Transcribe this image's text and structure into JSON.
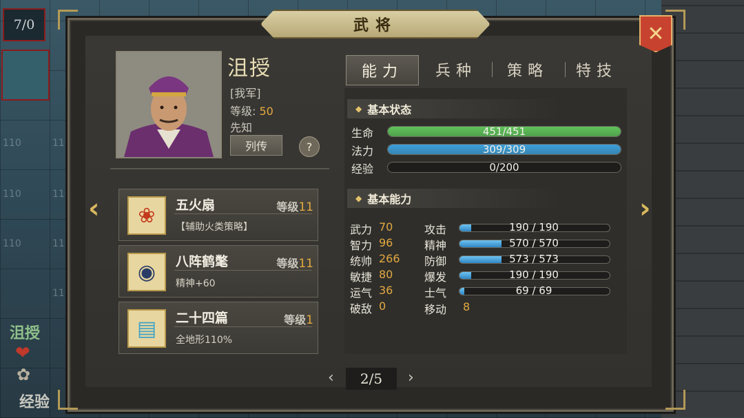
{
  "window": {
    "title": "武将",
    "close_icon": "close-x-icon"
  },
  "map": {
    "turn": "7/0",
    "tile_value": "110",
    "unit_name": "沮授",
    "exp_label": "经验"
  },
  "hero": {
    "name": "沮授",
    "faction": "[我军]",
    "level_label": "等级:",
    "level": "50",
    "skill": "先知",
    "bio_button": "列传",
    "help_button": "?"
  },
  "equipment": [
    {
      "name": "五火扇",
      "level_label": "等级",
      "level": "11",
      "desc": "【辅助火类策略】",
      "icon": "fire-fan-icon"
    },
    {
      "name": "八阵鹤氅",
      "level_label": "等级",
      "level": "11",
      "desc": "精神+60",
      "icon": "cloak-icon"
    },
    {
      "name": "二十四篇",
      "level_label": "等级",
      "level": "1",
      "desc": "全地形110%",
      "icon": "book-icon"
    }
  ],
  "tabs": [
    {
      "label": "能力",
      "active": true
    },
    {
      "label": "兵种",
      "active": false
    },
    {
      "label": "策略",
      "active": false
    },
    {
      "label": "特技",
      "active": false
    }
  ],
  "basic_status": {
    "header": "基本状态",
    "bars": [
      {
        "label": "生命",
        "text": "451/451",
        "fill": 1.0,
        "color": "#5fc25a"
      },
      {
        "label": "法力",
        "text": "309/309",
        "fill": 1.0,
        "color": "#3d9fd8"
      },
      {
        "label": "经验",
        "text": "0/200",
        "fill": 0.0,
        "color": "#e3a940"
      }
    ]
  },
  "basic_ability": {
    "header": "基本能力",
    "left": [
      {
        "name": "武力",
        "value": "70"
      },
      {
        "name": "智力",
        "value": "96"
      },
      {
        "name": "统帅",
        "value": "266"
      },
      {
        "name": "敏捷",
        "value": "80"
      },
      {
        "name": "运气",
        "value": "36"
      },
      {
        "name": "破敌",
        "value": "0"
      }
    ],
    "right": [
      {
        "name": "攻击",
        "text": "190 / 190",
        "fill": 0.08
      },
      {
        "name": "精神",
        "text": "570 / 570",
        "fill": 0.28
      },
      {
        "name": "防御",
        "text": "573 / 573",
        "fill": 0.28
      },
      {
        "name": "爆发",
        "text": "190 / 190",
        "fill": 0.08
      },
      {
        "name": "士气",
        "text": "69 / 69",
        "fill": 0.03
      }
    ],
    "move_label": "移动",
    "move_value": "8"
  },
  "pager": {
    "text": "2/5",
    "prev": "‹",
    "next": "›"
  },
  "colors": {
    "accent": "#e3a940",
    "hp": "#5fc25a",
    "mp": "#3d9fd8",
    "close": "#c7432f"
  }
}
